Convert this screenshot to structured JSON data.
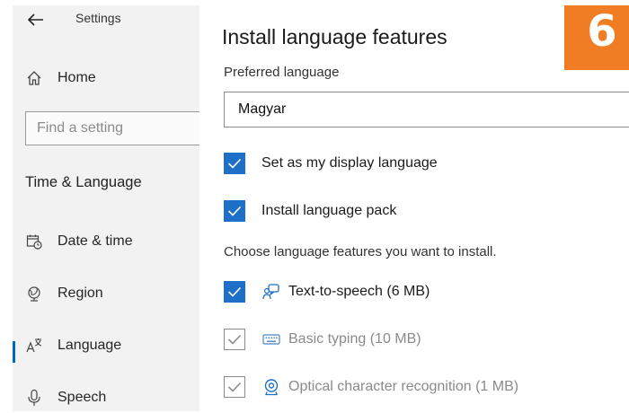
{
  "app": {
    "title": "Settings"
  },
  "sidebar": {
    "home_label": "Home",
    "search_placeholder": "Find a setting",
    "section_title": "Time & Language",
    "items": [
      {
        "label": "Date & time",
        "icon": "calendar-clock-icon"
      },
      {
        "label": "Region",
        "icon": "globe-icon"
      },
      {
        "label": "Language",
        "icon": "language-icon",
        "selected": true
      },
      {
        "label": "Speech",
        "icon": "microphone-icon"
      }
    ]
  },
  "main": {
    "title": "Install language features",
    "preferred_label": "Preferred language",
    "preferred_value": "Magyar",
    "options": [
      {
        "label": "Set as my display language",
        "checked": true
      },
      {
        "label": "Install language pack",
        "checked": true
      }
    ],
    "features_intro": "Choose language features you want to install.",
    "features": [
      {
        "label": "Text-to-speech (6 MB)",
        "checked": true,
        "enabled": true,
        "icon": "speech-bubble-icon"
      },
      {
        "label": "Basic typing (10 MB)",
        "checked": true,
        "enabled": false,
        "icon": "keyboard-icon"
      },
      {
        "label": "Optical character recognition (1 MB)",
        "checked": true,
        "enabled": false,
        "icon": "camera-icon"
      }
    ]
  },
  "badge": {
    "text": "6",
    "color": "#f07c24"
  },
  "colors": {
    "accent": "#1e6fc8",
    "sidebar_bg": "#f2f2f2"
  }
}
